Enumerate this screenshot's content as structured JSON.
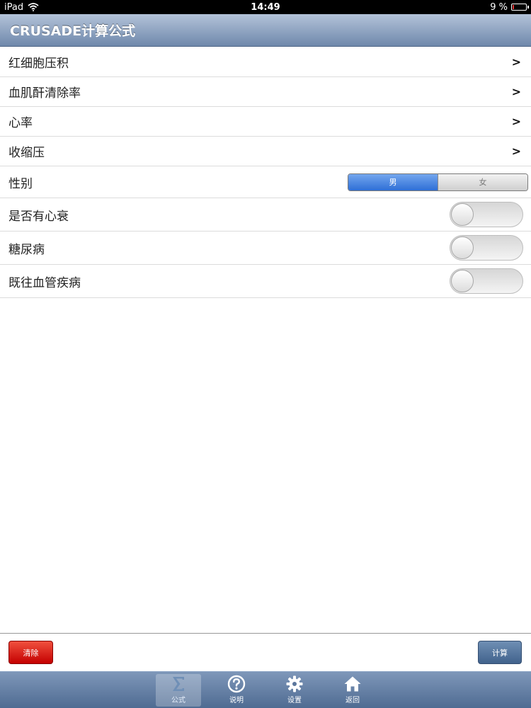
{
  "status_bar": {
    "device": "iPad",
    "time": "14:49",
    "battery": "9 %"
  },
  "nav": {
    "title": "CRUSADE计算公式"
  },
  "rows": [
    {
      "label": "红细胞压积",
      "type": "disclosure",
      "accessory": ">"
    },
    {
      "label": "血肌酐清除率",
      "type": "disclosure",
      "accessory": ">"
    },
    {
      "label": "心率",
      "type": "disclosure",
      "accessory": ">"
    },
    {
      "label": "收缩压",
      "type": "disclosure",
      "accessory": ">"
    },
    {
      "label": "性别",
      "type": "segmented",
      "options": [
        "男",
        "女"
      ],
      "selected": "男"
    },
    {
      "label": "是否有心衰",
      "type": "switch",
      "on": false
    },
    {
      "label": "糖尿病",
      "type": "switch",
      "on": false
    },
    {
      "label": "既往血管疾病",
      "type": "switch",
      "on": false
    }
  ],
  "actions": {
    "clear_label": "清除",
    "calc_label": "计算"
  },
  "tabs": [
    {
      "label": "公式",
      "icon": "sigma-icon",
      "selected": true
    },
    {
      "label": "说明",
      "icon": "question-icon",
      "selected": false
    },
    {
      "label": "设置",
      "icon": "gear-icon",
      "selected": false
    },
    {
      "label": "返回",
      "icon": "home-icon",
      "selected": false
    }
  ],
  "colors": {
    "nav_top": "#b3c3d9",
    "nav_bottom": "#6f88ab",
    "clear_button": "#c40000",
    "calc_button": "#41628c",
    "segment_active": "#2e6fd6"
  }
}
